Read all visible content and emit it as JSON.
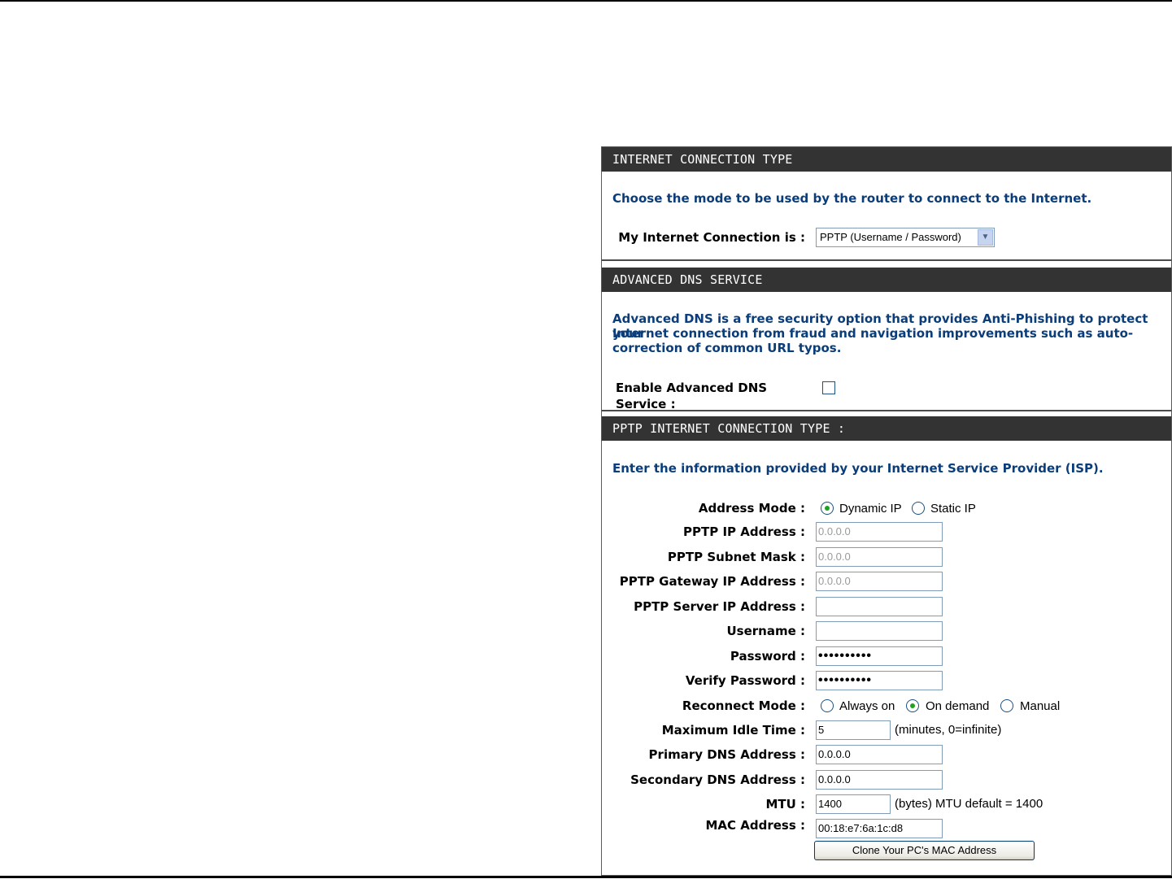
{
  "internet_connection_type": {
    "header": "INTERNET CONNECTION TYPE",
    "intro": "Choose the mode to be used by the router to connect to the Internet.",
    "connection_label": "My Internet Connection is :",
    "connection_value": "PPTP (Username / Password)"
  },
  "advanced_dns": {
    "header": "ADVANCED DNS SERVICE",
    "intro_line1": "Advanced DNS is a free security option that provides Anti-Phishing to protect your",
    "intro_line2": "Internet connection from fraud and navigation improvements such as auto-",
    "intro_line3": "correction of common URL typos.",
    "enable_label": "Enable Advanced DNS Service :",
    "enabled": false
  },
  "pptp": {
    "header": "PPTP INTERNET CONNECTION TYPE :",
    "intro": "Enter the information provided by your Internet Service Provider (ISP).",
    "address_mode": {
      "label": "Address Mode :",
      "options": [
        "Dynamic IP",
        "Static IP"
      ],
      "selected": "Dynamic IP"
    },
    "ip_address": {
      "label": "PPTP IP Address :",
      "value": "0.0.0.0"
    },
    "subnet_mask": {
      "label": "PPTP Subnet Mask :",
      "value": "0.0.0.0"
    },
    "gateway": {
      "label": "PPTP Gateway IP Address :",
      "value": "0.0.0.0"
    },
    "server_ip": {
      "label": "PPTP Server IP Address :",
      "value": ""
    },
    "username": {
      "label": "Username :",
      "value": ""
    },
    "password": {
      "label": "Password :",
      "value": "••••••••••"
    },
    "verify_password": {
      "label": "Verify Password :",
      "value": "••••••••••"
    },
    "reconnect_mode": {
      "label": "Reconnect Mode :",
      "options": [
        "Always on",
        "On demand",
        "Manual"
      ],
      "selected": "On demand"
    },
    "max_idle": {
      "label": "Maximum Idle Time :",
      "value": "5",
      "suffix": "(minutes, 0=infinite)"
    },
    "primary_dns": {
      "label": "Primary DNS Address :",
      "value": "0.0.0.0"
    },
    "secondary_dns": {
      "label": "Secondary DNS Address :",
      "value": "0.0.0.0"
    },
    "mtu": {
      "label": "MTU :",
      "value": "1400",
      "suffix": "(bytes) MTU default = 1400"
    },
    "mac": {
      "label": "MAC Address :",
      "value": "00:18:e7:6a:1c:d8"
    },
    "clone_button": "Clone Your PC's MAC Address"
  },
  "colors": {
    "header_bg": "#333333",
    "intro_text": "#0a3d7a",
    "radio_dot": "#21a121"
  }
}
